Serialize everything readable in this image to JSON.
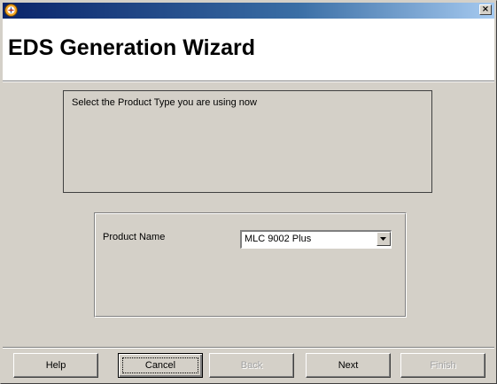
{
  "window": {
    "icon": "app-icon",
    "close_label": "×"
  },
  "header": {
    "title": "EDS Generation Wizard"
  },
  "instruction": {
    "text": "Select the Product Type  you are using now"
  },
  "product": {
    "label": "Product Name",
    "selected_value": "MLC 9002 Plus"
  },
  "buttons": {
    "help": "Help",
    "cancel": "Cancel",
    "back": "Back",
    "next": "Next",
    "finish": "Finish"
  },
  "colors": {
    "titlebar_start": "#0a246a",
    "titlebar_end": "#a6caf0",
    "dialog_bg": "#d4d0c8",
    "header_bg": "#ffffff",
    "disabled_text": "#a0a0a0"
  }
}
